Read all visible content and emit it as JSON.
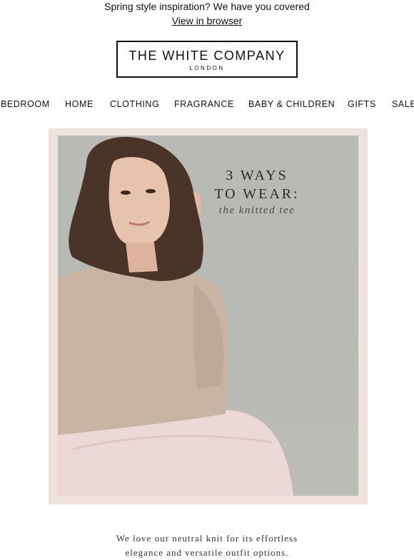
{
  "preheader": {
    "text": "Spring style inspiration? We have you covered",
    "view_in_browser": "View in browser"
  },
  "logo": {
    "main": "THE WHITE COMPANY",
    "sub": "LONDON"
  },
  "nav": {
    "items": [
      "BEDROOM",
      "HOME",
      "CLOTHING",
      "FRAGRANCE",
      "BABY & CHILDREN",
      "GIFTS",
      "SALE"
    ]
  },
  "hero": {
    "line1": "3 WAYS",
    "line2": "TO WEAR:",
    "line3": "the knitted tee",
    "frame_color": "#efe2dd"
  },
  "body": {
    "line1": "We love our neutral knit for its effortless",
    "line2": "elegance and versatile outfit options."
  }
}
